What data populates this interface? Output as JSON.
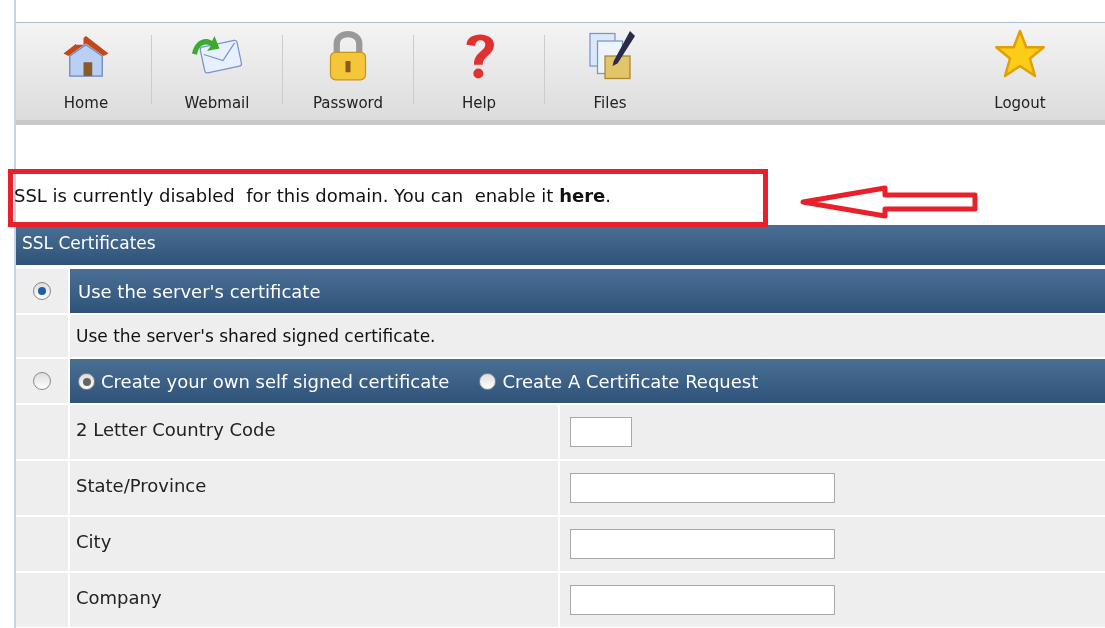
{
  "toolbar": {
    "items": [
      {
        "label": "Home",
        "kind": "home"
      },
      {
        "label": "Webmail",
        "kind": "mail"
      },
      {
        "label": "Password",
        "kind": "lock"
      },
      {
        "label": "Help",
        "kind": "help"
      },
      {
        "label": "Files",
        "kind": "files"
      }
    ],
    "logout": {
      "label": "Logout",
      "kind": "star"
    }
  },
  "notice": {
    "text_before": "SSL is currently disabled  for this domain. You can  enable it ",
    "link": "here",
    "text_after": "."
  },
  "panel": {
    "title": "SSL Certificates",
    "options": [
      {
        "selected": true,
        "title": "Use the server's certificate",
        "description": "Use the server's shared signed certificate."
      },
      {
        "selected": false,
        "choices": [
          {
            "label": "Create your own self signed certificate",
            "selected": true
          },
          {
            "label": "Create A Certificate Request",
            "selected": false
          }
        ],
        "fields": [
          {
            "label": "2 Letter Country Code",
            "kind": "short"
          },
          {
            "label": "State/Province",
            "kind": "long"
          },
          {
            "label": "City",
            "kind": "long"
          },
          {
            "label": "Company",
            "kind": "long"
          }
        ]
      }
    ]
  }
}
